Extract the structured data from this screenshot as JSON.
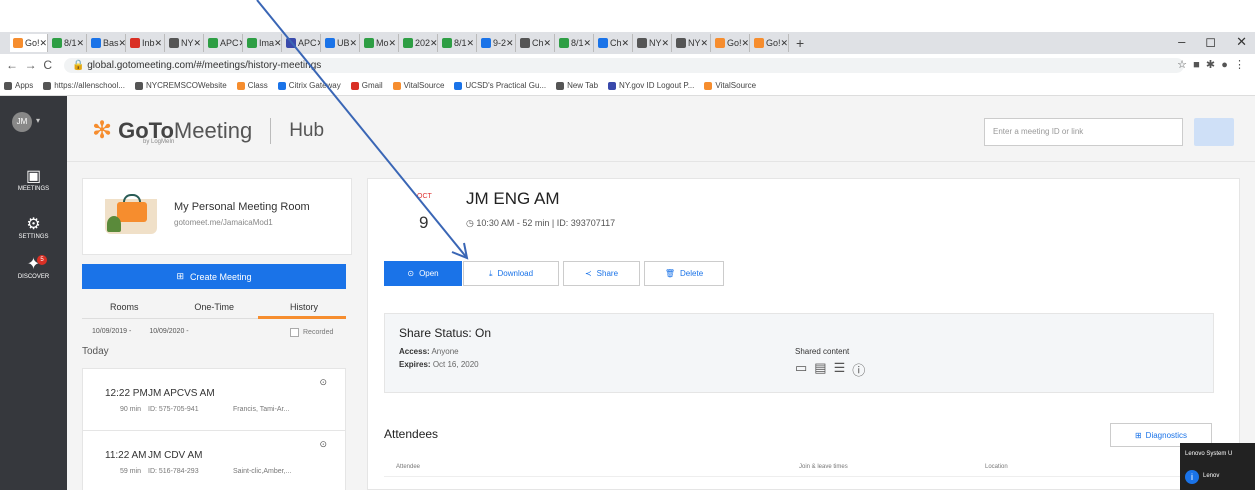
{
  "browser": {
    "tabs": [
      {
        "label": "Go!",
        "color": "#f68d2e"
      },
      {
        "label": "8/1",
        "color": "#2e9e44"
      },
      {
        "label": "Bas",
        "color": "#1a73e8"
      },
      {
        "label": "Inb",
        "color": "#d93025"
      },
      {
        "label": "NY",
        "color": "#555"
      },
      {
        "label": "APC",
        "color": "#2e9e44"
      },
      {
        "label": "Ima",
        "color": "#2e9e44"
      },
      {
        "label": "APC",
        "color": "#3949ab"
      },
      {
        "label": "UB",
        "color": "#1a73e8"
      },
      {
        "label": "Mo",
        "color": "#2e9e44"
      },
      {
        "label": "202",
        "color": "#2e9e44"
      },
      {
        "label": "8/1",
        "color": "#2e9e44"
      },
      {
        "label": "9-2",
        "color": "#1a73e8"
      },
      {
        "label": "Ch",
        "color": "#555"
      },
      {
        "label": "8/1",
        "color": "#2e9e44"
      },
      {
        "label": "Ch",
        "color": "#1a73e8"
      },
      {
        "label": "NY",
        "color": "#555"
      },
      {
        "label": "NY",
        "color": "#555"
      },
      {
        "label": "Go!",
        "color": "#f68d2e"
      },
      {
        "label": "Go!",
        "color": "#f68d2e"
      }
    ],
    "new_tab": "+",
    "window_controls": [
      "–",
      "◻",
      "✕"
    ],
    "url": "global.gotomeeting.com/#/meetings/history-meetings",
    "bookmarks": [
      {
        "label": "Apps",
        "color": "#555"
      },
      {
        "label": "https://allenschool...",
        "color": "#555"
      },
      {
        "label": "NYCREMSCOWebsite",
        "color": "#555"
      },
      {
        "label": "Class",
        "color": "#f68d2e"
      },
      {
        "label": "Citrix Gateway",
        "color": "#1a73e8"
      },
      {
        "label": "Gmail",
        "color": "#d93025"
      },
      {
        "label": "VitalSource",
        "color": "#f68d2e"
      },
      {
        "label": "UCSD's Practical Gu...",
        "color": "#1a73e8"
      },
      {
        "label": "New Tab",
        "color": "#555"
      },
      {
        "label": "NY.gov ID Logout P...",
        "color": "#3949ab"
      },
      {
        "label": "VitalSource",
        "color": "#f68d2e"
      }
    ]
  },
  "sidebar": {
    "avatar": "JM",
    "items": [
      {
        "label": "MEETINGS",
        "icon": "calendar-icon"
      },
      {
        "label": "SETTINGS",
        "icon": "gear-icon"
      },
      {
        "label": "DISCOVER",
        "icon": "lightbulb-icon",
        "badge": "5"
      }
    ]
  },
  "header": {
    "brand_goto": "GoTo",
    "brand_meeting": "Meeting",
    "byline": "by LogMeIn",
    "hub": "Hub",
    "meeting_input_placeholder": "Enter a meeting ID or link"
  },
  "room": {
    "title": "My Personal Meeting Room",
    "url": "gotomeet.me/JamaicaMod1"
  },
  "create_button": "Create Meeting",
  "list_tabs": [
    "Rooms",
    "One-Time",
    "History"
  ],
  "active_list_tab": "History",
  "date_from": "10/09/2019 -",
  "date_to": "10/09/2020 -",
  "recorded_label": "Recorded",
  "today_label": "Today",
  "meetings": [
    {
      "time": "12:22 PM",
      "name": "JM APCVS AM",
      "duration": "90 min",
      "id": "ID: 575-705-941",
      "attendees": "Francis, Tami-Ar..."
    },
    {
      "time": "11:22 AM",
      "name": "JM CDV AM",
      "duration": "59 min",
      "id": "ID: 516-784-293",
      "attendees": "Saint-clic,Amber,..."
    }
  ],
  "detail": {
    "month": "OCT",
    "day": "9",
    "title": "JM ENG AM",
    "meta": "10:30 AM - 52 min | ID: 393707117",
    "buttons": {
      "open": "Open",
      "download": "Download",
      "share": "Share",
      "delete": "Delete"
    },
    "share_status": "Share Status: On",
    "access_label": "Access:",
    "access_value": "Anyone",
    "expires_label": "Expires:",
    "expires_value": "Oct 16, 2020",
    "shared_content": "Shared content",
    "attendees_title": "Attendees",
    "diagnostics": "Diagnostics",
    "columns": [
      "Attendee",
      "Join & leave times",
      "Location"
    ]
  },
  "lenovo_popup": {
    "title": "Lenovo System U",
    "text": "Lenov"
  },
  "colors": {
    "accent": "#1a73e8",
    "brand": "#f68d2e",
    "sidebar": "#36383d"
  }
}
